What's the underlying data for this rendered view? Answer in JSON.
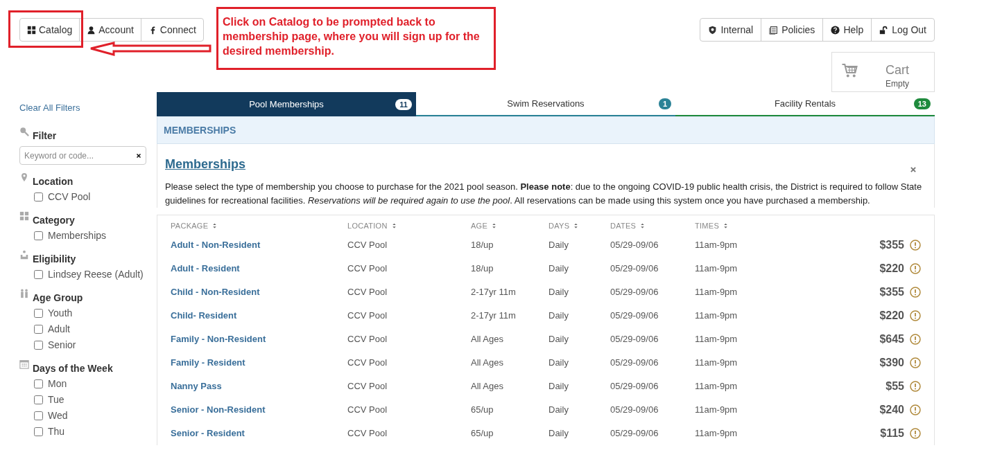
{
  "top_nav": [
    {
      "label": "Catalog"
    },
    {
      "label": "Account"
    },
    {
      "label": "Connect"
    }
  ],
  "user_nav": [
    {
      "label": "Internal"
    },
    {
      "label": "Policies"
    },
    {
      "label": "Help"
    },
    {
      "label": "Log Out"
    }
  ],
  "cart": {
    "title": "Cart",
    "status": "Empty"
  },
  "annotation": {
    "text": "Click on Catalog to be prompted back to membership page, where you will sign up for the desired membership."
  },
  "sidebar": {
    "clear_link": "Clear All Filters",
    "sections": [
      {
        "kind": "search",
        "title": "Filter",
        "placeholder": "Keyword or code..."
      },
      {
        "kind": "checkboxes",
        "title": "Location",
        "options": [
          {
            "label": "CCV Pool",
            "checked": false
          }
        ]
      },
      {
        "kind": "checkboxes",
        "title": "Category",
        "options": [
          {
            "label": "Memberships",
            "checked": false
          }
        ]
      },
      {
        "kind": "checkboxes",
        "title": "Eligibility",
        "options": [
          {
            "label": "Lindsey Reese (Adult)",
            "checked": false
          }
        ]
      },
      {
        "kind": "checkboxes",
        "title": "Age Group",
        "options": [
          {
            "label": "Youth",
            "checked": false
          },
          {
            "label": "Adult",
            "checked": false
          },
          {
            "label": "Senior",
            "checked": false
          }
        ]
      },
      {
        "kind": "checkboxes",
        "title": "Days of the Week",
        "options": [
          {
            "label": "Mon",
            "checked": false
          },
          {
            "label": "Tue",
            "checked": false
          },
          {
            "label": "Wed",
            "checked": false
          },
          {
            "label": "Thu",
            "checked": false
          }
        ]
      }
    ]
  },
  "tabs": [
    {
      "label": "Pool Memberships",
      "count": "11",
      "selected": true,
      "color": "#ffffff"
    },
    {
      "label": "Swim Reservations",
      "count": "1",
      "selected": false,
      "color": "#2a8296"
    },
    {
      "label": "Facility Rentals",
      "count": "13",
      "selected": false,
      "color": "#1e8a3c"
    }
  ],
  "section_header": "MEMBERSHIPS",
  "group": {
    "title": "Memberships",
    "description": "Please select the type of membership you choose to purchase for the 2021 pool season. **Please note**: due to the ongoing COVID-19 public health crisis, the District is required to follow State guidelines for recreational facilities. *Reservations will be required again to use the pool*. All reservations can be made using this system once you have purchased a membership."
  },
  "table": {
    "columns": [
      "PACKAGE",
      "LOCATION",
      "AGE",
      "DAYS",
      "DATES",
      "TIMES"
    ],
    "rows": [
      [
        "Adult - Non-Resident",
        "CCV Pool",
        "18/up",
        "Daily",
        "05/29-09/06",
        "11am-9pm",
        "$355"
      ],
      [
        "Adult - Resident",
        "CCV Pool",
        "18/up",
        "Daily",
        "05/29-09/06",
        "11am-9pm",
        "$220"
      ],
      [
        "Child - Non-Resident",
        "CCV Pool",
        "2-17yr 11m",
        "Daily",
        "05/29-09/06",
        "11am-9pm",
        "$355"
      ],
      [
        "Child- Resident",
        "CCV Pool",
        "2-17yr 11m",
        "Daily",
        "05/29-09/06",
        "11am-9pm",
        "$220"
      ],
      [
        "Family - Non-Resident",
        "CCV Pool",
        "All Ages",
        "Daily",
        "05/29-09/06",
        "11am-9pm",
        "$645"
      ],
      [
        "Family - Resident",
        "CCV Pool",
        "All Ages",
        "Daily",
        "05/29-09/06",
        "11am-9pm",
        "$390"
      ],
      [
        "Nanny Pass",
        "CCV Pool",
        "All Ages",
        "Daily",
        "05/29-09/06",
        "11am-9pm",
        "$55"
      ],
      [
        "Senior - Non-Resident",
        "CCV Pool",
        "65/up",
        "Daily",
        "05/29-09/06",
        "11am-9pm",
        "$240"
      ],
      [
        "Senior - Resident",
        "CCV Pool",
        "65/up",
        "Daily",
        "05/29-09/06",
        "11am-9pm",
        "$115"
      ]
    ]
  }
}
